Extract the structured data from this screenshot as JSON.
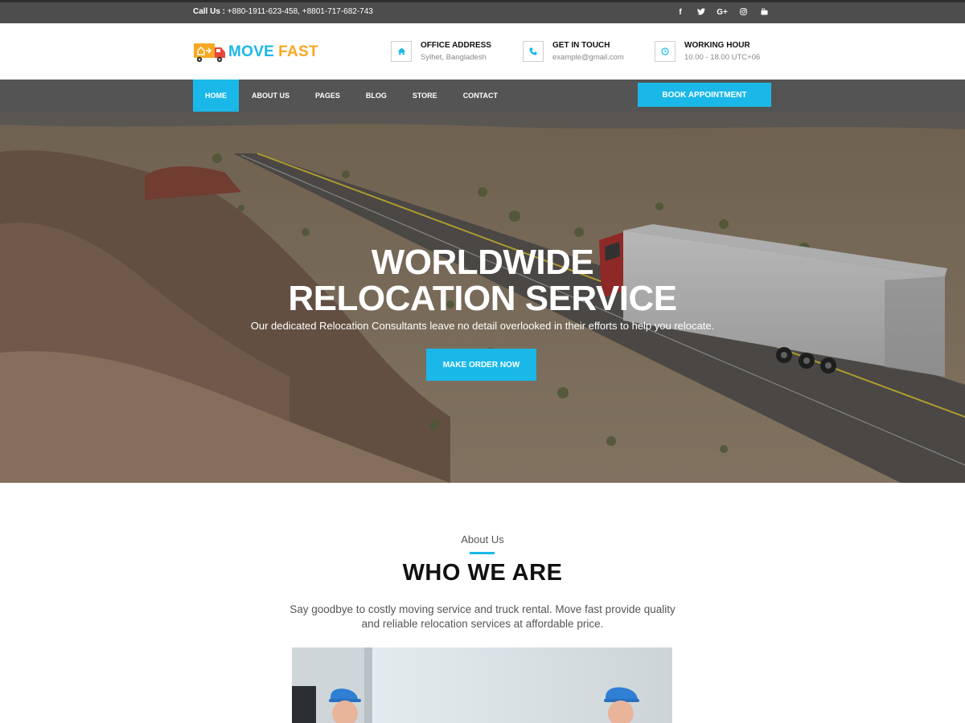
{
  "topbar": {
    "call_label": "Call Us :",
    "call_numbers": "+880-1911-623-458, +8801-717-682-743",
    "social": [
      {
        "icon": "facebook-icon",
        "glyph": "f"
      },
      {
        "icon": "twitter-icon",
        "glyph": "🐦"
      },
      {
        "icon": "google-plus-icon",
        "glyph": "G+"
      },
      {
        "icon": "instagram-icon",
        "glyph": "◎"
      },
      {
        "icon": "youtube-icon",
        "glyph": "▶"
      }
    ]
  },
  "header": {
    "logo_part1": "MOVE",
    "logo_part2": "FAST",
    "info": [
      {
        "icon": "home-icon",
        "title": "OFFICE ADDRESS",
        "sub": "Sylhet, Bangladesh"
      },
      {
        "icon": "phone-icon",
        "title": "GET IN TOUCH",
        "sub": "example@gmail.com"
      },
      {
        "icon": "clock-icon",
        "title": "WORKING HOUR",
        "sub": "10.00 - 18.00 UTC+06"
      }
    ]
  },
  "nav": {
    "items": [
      "HOME",
      "ABOUT US",
      "PAGES",
      "BLOG",
      "STORE",
      "CONTACT"
    ],
    "active": "HOME",
    "book_label": "BOOK APPOINTMENT"
  },
  "hero": {
    "title_line1": "WORLDWIDE",
    "title_line2": "RELOCATION SERVICE",
    "description": "Our dedicated Relocation Consultants leave no detail overlooked in their efforts to help you relocate.",
    "button_label": "MAKE ORDER NOW"
  },
  "about": {
    "label": "About Us",
    "title": "WHO WE ARE",
    "text": "Say goodbye to costly moving service and truck rental. Move fast provide quality and reliable relocation services at affordable price."
  },
  "colors": {
    "accent": "#1ab8e8",
    "logo_secondary": "#f7a823",
    "topbar_bg": "#4d4d4d",
    "nav_bg": "#545454"
  }
}
